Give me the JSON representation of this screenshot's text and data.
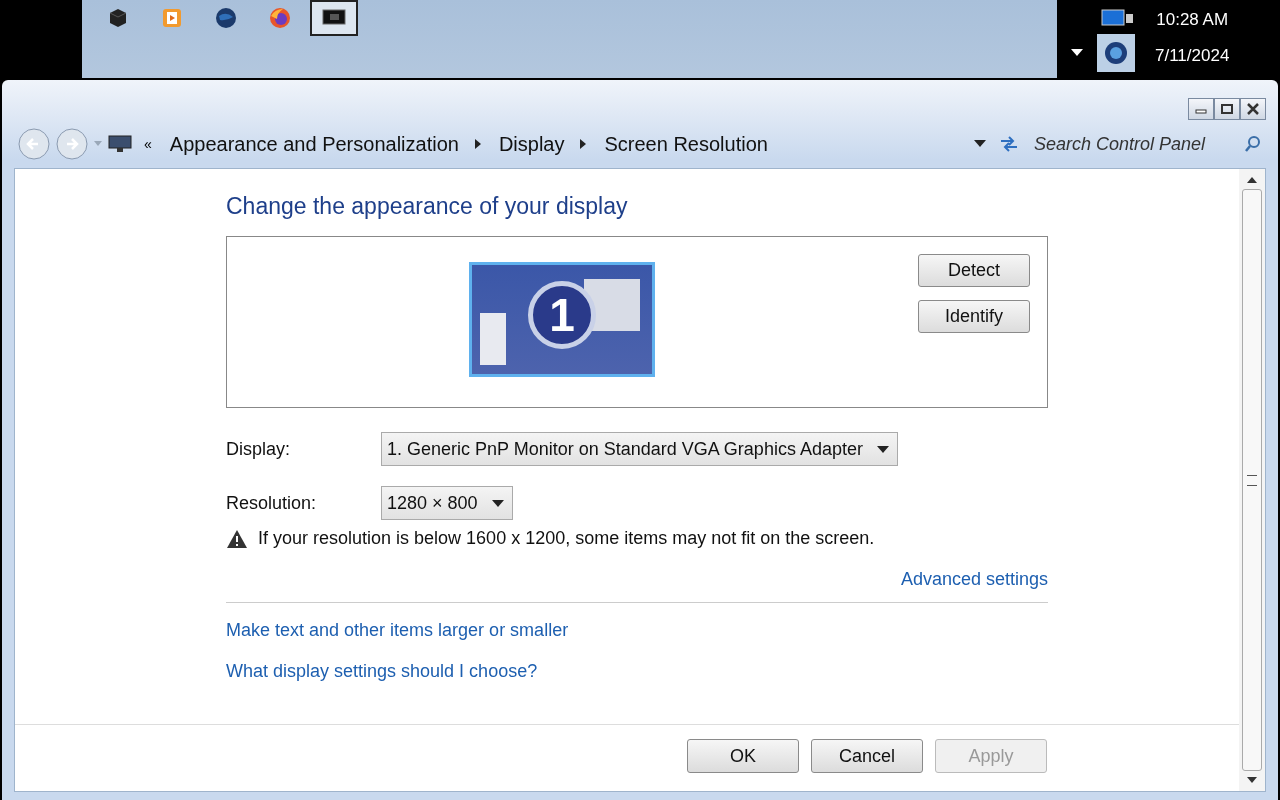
{
  "taskbar": {
    "apps": [
      {
        "kind": "cube",
        "selected": false
      },
      {
        "kind": "media",
        "selected": false
      },
      {
        "kind": "globe",
        "selected": false
      },
      {
        "kind": "fox",
        "selected": false
      },
      {
        "kind": "monitor",
        "selected": true
      }
    ],
    "tray": {
      "time": "10:28 AM",
      "date": "7/11/2024"
    }
  },
  "address_bar": {
    "overflow": "«",
    "breadcrumbs": [
      "Appearance and Personalization",
      "Display",
      "Screen Resolution"
    ],
    "search": {
      "placeholder": "Search Control Panel"
    }
  },
  "content": {
    "title": "Change the appearance of your display",
    "monitor": {
      "number": "1"
    },
    "buttons": [
      {
        "label": "Detect"
      },
      {
        "label": "Identify"
      }
    ],
    "fields": [
      {
        "label": "Display:",
        "value": "1. Generic PnP Monitor on Standard VGA Graphics Adapter"
      },
      {
        "label": "Resolution:",
        "value": "1280 × 800"
      }
    ],
    "warning": "If your resolution is below 1600 x 1200, some items may not fit on the screen.",
    "advanced_link": "Advanced settings",
    "links": [
      "Make text and other items larger or smaller",
      "What display settings should I choose?"
    ]
  },
  "footer": {
    "buttons": [
      {
        "label": "OK",
        "disabled": false
      },
      {
        "label": "Cancel",
        "disabled": false
      },
      {
        "label": "Apply",
        "disabled": true
      }
    ]
  }
}
